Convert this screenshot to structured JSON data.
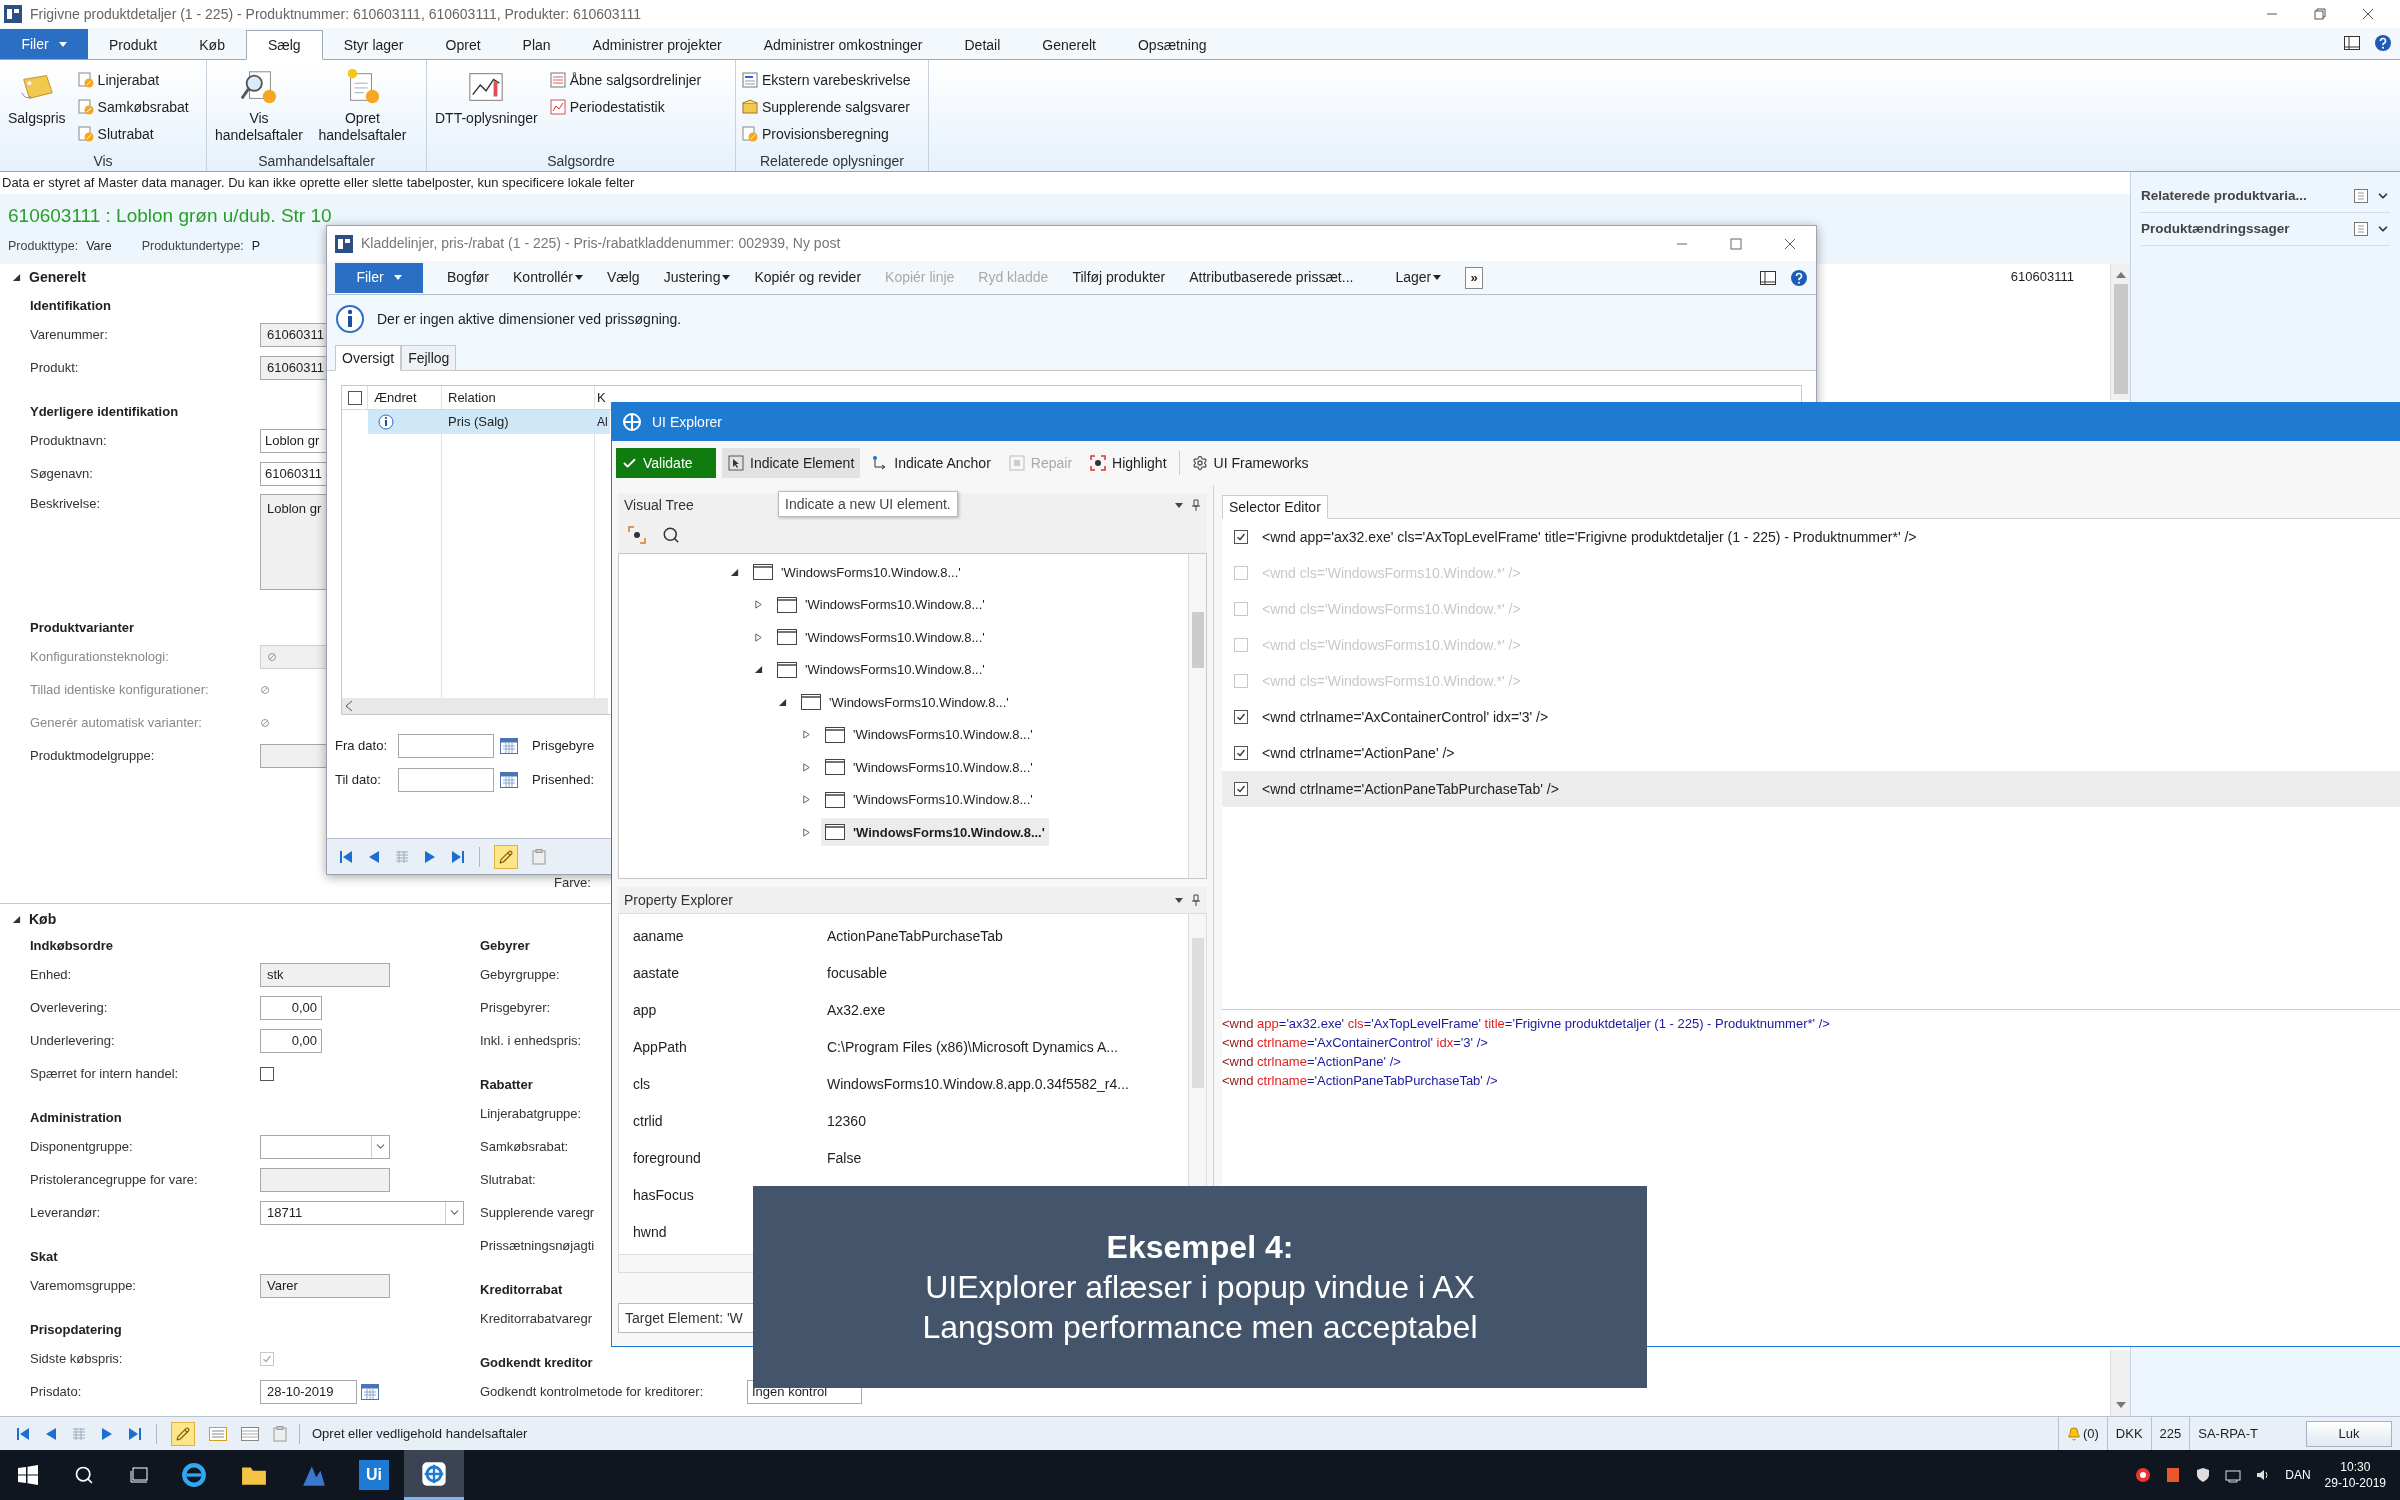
{
  "main_window": {
    "title": "Frigivne produktdetaljer (1 - 225) - Produktnummer: 610603111, 610603111, Produkter: 610603111",
    "file_button": "Filer"
  },
  "ribbon_tabs": [
    {
      "label": "Produkt",
      "selected": false
    },
    {
      "label": "Køb",
      "selected": false
    },
    {
      "label": "Sælg",
      "selected": true
    },
    {
      "label": "Styr lager",
      "selected": false
    },
    {
      "label": "Opret",
      "selected": false
    },
    {
      "label": "Plan",
      "selected": false
    },
    {
      "label": "Administrer projekter",
      "selected": false
    },
    {
      "label": "Administrer omkostninger",
      "selected": false
    },
    {
      "label": "Detail",
      "selected": false
    },
    {
      "label": "Generelt",
      "selected": false
    },
    {
      "label": "Opsætning",
      "selected": false
    }
  ],
  "ribbon_groups": [
    {
      "label": "Vis",
      "items": [
        {
          "kind": "large",
          "label": "Salgspris"
        },
        {
          "kind": "small",
          "label": "Linjerabat"
        },
        {
          "kind": "small",
          "label": "Samkøbsrabat"
        },
        {
          "kind": "small",
          "label": "Slutrabat"
        }
      ]
    },
    {
      "label": "Samhandelsaftaler",
      "items": [
        {
          "kind": "large",
          "label": "Vis handelsaftaler"
        },
        {
          "kind": "large",
          "label": "Opret handelsaftaler"
        }
      ]
    },
    {
      "label": "Salgsordre",
      "items": [
        {
          "kind": "large",
          "label": "DTT-oplysninger"
        },
        {
          "kind": "small",
          "label": "Åbne salgsordrelinjer"
        },
        {
          "kind": "small",
          "label": "Periodestatistik"
        }
      ]
    },
    {
      "label": "Relaterede oplysninger",
      "items": [
        {
          "kind": "small",
          "label": "Ekstern varebeskrivelse"
        },
        {
          "kind": "small",
          "label": "Supplerende salgsvarer"
        },
        {
          "kind": "small",
          "label": "Provisionsberegning"
        }
      ]
    }
  ],
  "notice": "Data er styret af Master data manager. Du kan ikke oprette eller slette tabelposter, kun specificere lokale felter",
  "record_title": "610603111 : Loblon grøn u/dub. Str 10",
  "header_fields": [
    {
      "label": "Produkttype:",
      "value": "Vare"
    },
    {
      "label": "Produktundertype:",
      "value": "P"
    }
  ],
  "factboxes": [
    "Relaterede produktvaria...",
    "Produktændringssager"
  ],
  "general": {
    "title": "Generelt",
    "expanded": true,
    "record_id": "610603111",
    "groups": [
      {
        "title": "Identifikation",
        "rows": [
          {
            "label": "Varenummer:",
            "kind": "readonly",
            "value": "61060311"
          },
          {
            "label": "Produkt:",
            "kind": "readonly",
            "value": "61060311"
          }
        ]
      },
      {
        "title": "Yderligere identifikation",
        "rows": [
          {
            "label": "Produktnavn:",
            "kind": "text",
            "value": "Loblon gr"
          },
          {
            "label": "Søgenavn:",
            "kind": "text",
            "value": "61060311"
          },
          {
            "label": "Beskrivelse:",
            "kind": "multiline",
            "value": "Loblon gr"
          }
        ]
      },
      {
        "title": "Produktvarianter",
        "rows": [
          {
            "label": "Konfigurationsteknologi:",
            "kind": "locked-field"
          },
          {
            "label": "Tillad identiske konfigurationer:",
            "kind": "locked-check"
          },
          {
            "label": "Generér automatisk varianter:",
            "kind": "locked-check"
          },
          {
            "label": "Produktmodelgruppe:",
            "kind": "readonly"
          }
        ]
      }
    ],
    "side_label": "Farve:"
  },
  "purchase": {
    "title": "Køb",
    "expanded": true,
    "left_groups": [
      {
        "title": "Indkøbsordre",
        "rows": [
          {
            "label": "Enhed:",
            "kind": "readonly",
            "value": "stk"
          },
          {
            "label": "Overlevering:",
            "kind": "number",
            "value": "0,00"
          },
          {
            "label": "Underlevering:",
            "kind": "number",
            "value": "0,00"
          },
          {
            "label": "Spærret for intern handel:",
            "kind": "check",
            "checked": false
          }
        ]
      },
      {
        "title": "Administration",
        "rows": [
          {
            "label": "Disponentgruppe:",
            "kind": "select"
          },
          {
            "label": "Pristolerancegruppe for vare:",
            "kind": "readonly"
          },
          {
            "label": "Leverandør:",
            "kind": "lookup",
            "value": "18711"
          }
        ]
      },
      {
        "title": "Skat",
        "rows": [
          {
            "label": "Varemomsgruppe:",
            "kind": "readonly",
            "value": "Varer"
          }
        ]
      },
      {
        "title": "Prisopdatering",
        "rows": [
          {
            "label": "Sidste købspris:",
            "kind": "check",
            "checked": true
          },
          {
            "label": "Prisdato:",
            "kind": "date",
            "value": "28-10-2019"
          }
        ]
      }
    ],
    "right_groups": [
      {
        "title": "Gebyrer",
        "rows": [
          {
            "label": "Gebyrgruppe:",
            "kind": "label"
          },
          {
            "label": "Prisgebyrer:",
            "kind": "label"
          },
          {
            "label": "Inkl. i enhedspris:",
            "kind": "label"
          }
        ]
      },
      {
        "title": "Rabatter",
        "rows": [
          {
            "label": "Linjerabatgruppe:",
            "kind": "label"
          },
          {
            "label": "Samkøbsrabat:",
            "kind": "label"
          },
          {
            "label": "Slutrabat:",
            "kind": "label"
          },
          {
            "label": "Supplerende varegr",
            "kind": "label"
          },
          {
            "label": "Prissætningsnøjagti",
            "kind": "label"
          }
        ]
      },
      {
        "title": "Kreditorrabat",
        "rows": [
          {
            "label": "Kreditorrabatvaregr",
            "kind": "label"
          }
        ]
      },
      {
        "title": "Godkendt kreditor",
        "rows": [
          {
            "label": "Godkendt kontrolmetode for kreditorer:",
            "kind": "text",
            "value": "Ingen kontrol"
          }
        ]
      }
    ]
  },
  "journal_window": {
    "title": "Kladdelinjer, pris-/rabat (1 - 225) - Pris-/rabatkladdenummer: 002939, Ny post",
    "file_button": "Filer",
    "actions": [
      {
        "label": "Bogfør",
        "dropdown": false,
        "disabled": false
      },
      {
        "label": "Kontrollér",
        "dropdown": true,
        "disabled": false
      },
      {
        "label": "Vælg",
        "dropdown": false,
        "disabled": false
      },
      {
        "label": "Justering",
        "dropdown": true,
        "disabled": false
      },
      {
        "label": "Kopiér og revider",
        "dropdown": false,
        "disabled": false
      },
      {
        "label": "Kopiér linje",
        "dropdown": false,
        "disabled": true
      },
      {
        "label": "Ryd kladde",
        "dropdown": false,
        "disabled": true
      },
      {
        "label": "Tilføj produkter",
        "dropdown": false,
        "disabled": false
      },
      {
        "label": "Attributbaserede prissæt...",
        "dropdown": false,
        "disabled": false
      },
      {
        "label": "Lager",
        "dropdown": true,
        "disabled": false
      }
    ],
    "overflow_button": "»",
    "info": "Der er ingen aktive dimensioner ved prissøgning.",
    "tabs": [
      {
        "label": "Oversigt",
        "selected": true
      },
      {
        "label": "Fejllog",
        "selected": false
      }
    ],
    "columns": [
      "Ændret",
      "Relation",
      "K"
    ],
    "select_all_checked": false,
    "rows": [
      {
        "relation": "Pris (Salg)",
        "column_3": "Al",
        "selected": true
      }
    ],
    "date_fields": [
      {
        "label": "Fra dato:"
      },
      {
        "label": "Til dato:"
      }
    ],
    "side_labels": [
      "Prisgebyre",
      "Prisenhed:"
    ]
  },
  "explorer": {
    "title": "UI Explorer",
    "toolbar": [
      {
        "kind": "validate",
        "label": "Validate",
        "disabled": false,
        "hovered": false
      },
      {
        "kind": "indicate",
        "label": "Indicate Element",
        "disabled": false,
        "hovered": true
      },
      {
        "kind": "anchor",
        "label": "Indicate Anchor",
        "disabled": false,
        "hovered": false
      },
      {
        "kind": "repair",
        "label": "Repair",
        "disabled": true,
        "hovered": false
      },
      {
        "kind": "highlight",
        "label": "Highlight",
        "disabled": false,
        "hovered": false
      },
      {
        "kind": "frameworks",
        "label": "UI Frameworks",
        "disabled": false,
        "hovered": false
      }
    ],
    "tooltip": "Indicate a new UI element.",
    "visual_tree": {
      "title": "Visual Tree",
      "nodes": [
        {
          "label": "'WindowsForms10.Window.8...'",
          "expanded": true,
          "selected": false,
          "children": [
            {
              "label": "'WindowsForms10.Window.8...'",
              "expanded": false,
              "selected": false
            },
            {
              "label": "'WindowsForms10.Window.8...'",
              "expanded": false,
              "selected": false
            },
            {
              "label": "'WindowsForms10.Window.8...'",
              "expanded": true,
              "selected": false,
              "children": [
                {
                  "label": "'WindowsForms10.Window.8...'",
                  "expanded": true,
                  "selected": false,
                  "children": [
                    {
                      "label": "'WindowsForms10.Window.8...'",
                      "expanded": false,
                      "selected": false
                    },
                    {
                      "label": "'WindowsForms10.Window.8...'",
                      "expanded": false,
                      "selected": false
                    },
                    {
                      "label": "'WindowsForms10.Window.8...'",
                      "expanded": false,
                      "selected": false
                    },
                    {
                      "label": "'WindowsForms10.Window.8...'",
                      "expanded": false,
                      "selected": true
                    }
                  ]
                }
              ]
            }
          ]
        }
      ]
    },
    "property_explorer": {
      "title": "Property Explorer",
      "properties": [
        {
          "name": "aaname",
          "value": "ActionPaneTabPurchaseTab"
        },
        {
          "name": "aastate",
          "value": "focusable"
        },
        {
          "name": "app",
          "value": "Ax32.exe"
        },
        {
          "name": "AppPath",
          "value": "C:\\Program Files (x86)\\Microsoft Dynamics A..."
        },
        {
          "name": "cls",
          "value": "WindowsForms10.Window.8.app.0.34f5582_r4..."
        },
        {
          "name": "ctrlid",
          "value": "12360"
        },
        {
          "name": "foreground",
          "value": "False"
        },
        {
          "name": "hasFocus"
        },
        {
          "name": "hwnd"
        }
      ]
    },
    "target_element": "Target Element: 'W",
    "selector_editor": {
      "tab": "Selector Editor",
      "rows": [
        {
          "text": "<wnd app='ax32.exe' cls='AxTopLevelFrame' title='Frigivne produktdetaljer (1 - 225) - Produktnummer*' />",
          "checked": true,
          "selected": false
        },
        {
          "text": "<wnd cls='WindowsForms10.Window.*' />",
          "checked": false,
          "selected": false
        },
        {
          "text": "<wnd cls='WindowsForms10.Window.*' />",
          "checked": false,
          "selected": false
        },
        {
          "text": "<wnd cls='WindowsForms10.Window.*' />",
          "checked": false,
          "selected": false
        },
        {
          "text": "<wnd cls='WindowsForms10.Window.*' />",
          "checked": false,
          "selected": false
        },
        {
          "text": "<wnd ctrlname='AxContainerControl' idx='3' />",
          "checked": true,
          "selected": false
        },
        {
          "text": "<wnd ctrlname='ActionPane' />",
          "checked": true,
          "selected": false
        },
        {
          "text": "<wnd ctrlname='ActionPaneTabPurchaseTab' />",
          "checked": true,
          "selected": true
        }
      ],
      "code": [
        "<wnd app='ax32.exe' cls='AxTopLevelFrame' title='Frigivne produktdetaljer (1 - 225) - Produktnummer*' />",
        "<wnd ctrlname='AxContainerControl' idx='3' />",
        "<wnd ctrlname='ActionPane' />",
        "<wnd ctrlname='ActionPaneTabPurchaseTab' />"
      ]
    }
  },
  "caption": {
    "title": "Eksempel 4:",
    "lines": [
      "UIExplorer aflæser i popup vindue i AX",
      "Langsom performance men acceptabel"
    ]
  },
  "status_bar": {
    "message": "Opret eller vedligehold handelsaftaler",
    "notifications": "(0)",
    "items": [
      "DKK",
      "225",
      "SA-RPA-T"
    ],
    "close_button": "Luk"
  },
  "taskbar": {
    "apps": [
      {
        "kind": "browser",
        "selected": false
      },
      {
        "kind": "folder",
        "selected": false
      },
      {
        "kind": "dynamics",
        "selected": false
      },
      {
        "kind": "uipath",
        "label": "Ui",
        "selected": false
      },
      {
        "kind": "explorer",
        "selected": true
      }
    ],
    "language": "DAN",
    "time": "10:30",
    "date": "29-10-2019"
  }
}
